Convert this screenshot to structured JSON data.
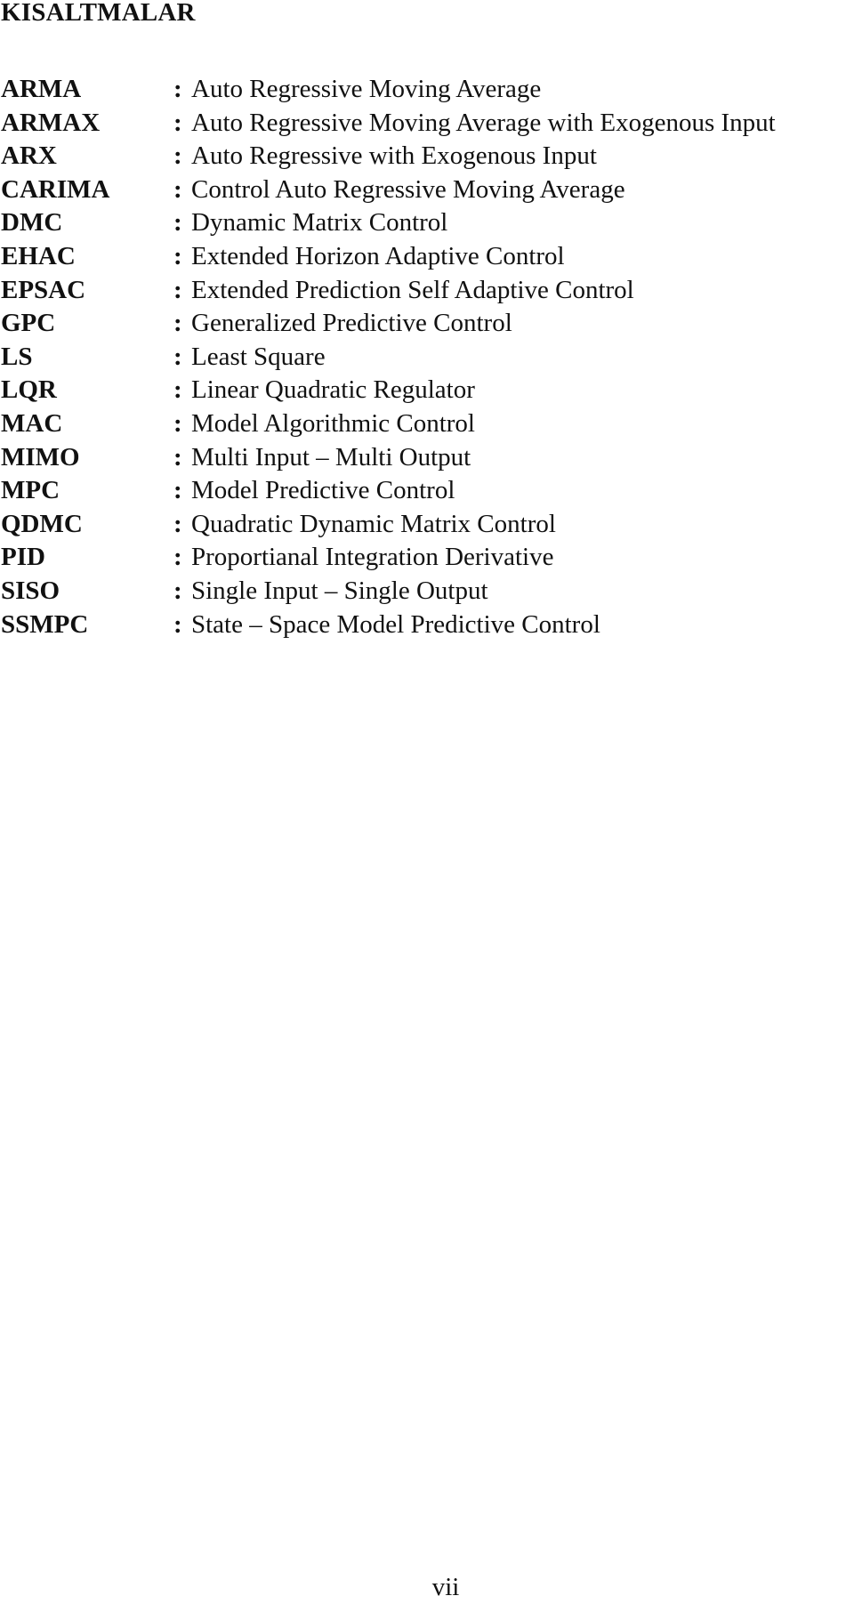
{
  "page": {
    "title": "KISALTMALAR",
    "page_number": "vii"
  },
  "abbreviations": [
    {
      "term": "ARMA",
      "separator": ":",
      "definition": "Auto Regressive Moving Average"
    },
    {
      "term": "ARMAX",
      "separator": ":",
      "definition": "Auto Regressive Moving Average with Exogenous Input"
    },
    {
      "term": "ARX",
      "separator": ":",
      "definition": "Auto Regressive with Exogenous Input"
    },
    {
      "term": "CARIMA",
      "separator": ":",
      "definition": "Control Auto Regressive Moving Average"
    },
    {
      "term": "DMC",
      "separator": ":",
      "definition": "Dynamic Matrix Control"
    },
    {
      "term": "EHAC",
      "separator": ":",
      "definition": "Extended Horizon Adaptive Control"
    },
    {
      "term": "EPSAC",
      "separator": ":",
      "definition": "Extended Prediction Self Adaptive Control"
    },
    {
      "term": "GPC",
      "separator": ":",
      "definition": "Generalized Predictive Control"
    },
    {
      "term": "LS",
      "separator": ":",
      "definition": "Least Square"
    },
    {
      "term": "LQR",
      "separator": ":",
      "definition": "Linear Quadratic Regulator"
    },
    {
      "term": "MAC",
      "separator": ":",
      "definition": "Model Algorithmic Control"
    },
    {
      "term": "MIMO",
      "separator": ":",
      "definition": "Multi Input – Multi Output"
    },
    {
      "term": "MPC",
      "separator": ":",
      "definition": "Model Predictive Control"
    },
    {
      "term": "QDMC",
      "separator": ":",
      "definition": "Quadratic Dynamic Matrix Control"
    },
    {
      "term": "PID",
      "separator": ":",
      "definition": "Proportianal Integration Derivative"
    },
    {
      "term": "SISO",
      "separator": ":",
      "definition": "Single Input – Single Output"
    },
    {
      "term": "SSMPC",
      "separator": ":",
      "definition": "State – Space Model Predictive Control"
    }
  ]
}
